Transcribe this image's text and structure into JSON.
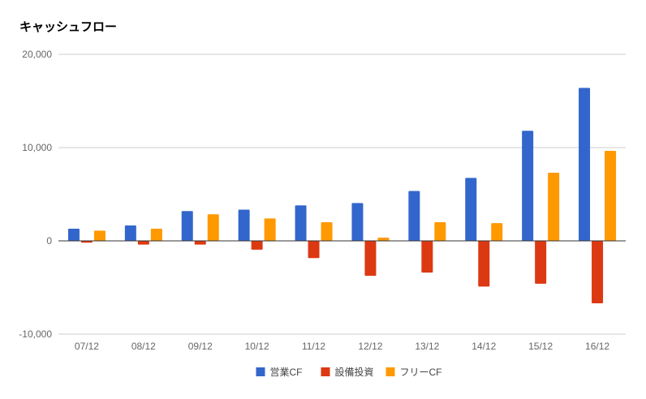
{
  "chart_data": {
    "type": "bar",
    "title": "キャッシュフロー",
    "categories": [
      "07/12",
      "08/12",
      "09/12",
      "10/12",
      "11/12",
      "12/12",
      "13/12",
      "14/12",
      "15/12",
      "16/12"
    ],
    "series": [
      {
        "name": "営業CF",
        "color": "#3366cc",
        "values": [
          1300,
          1650,
          3200,
          3350,
          3800,
          4050,
          5350,
          6750,
          11800,
          16400
        ]
      },
      {
        "name": "設備投資",
        "color": "#dc3912",
        "values": [
          -200,
          -400,
          -400,
          -950,
          -1850,
          -3750,
          -3400,
          -4900,
          -4600,
          -6700
        ]
      },
      {
        "name": "フリーCF",
        "color": "#ff9900",
        "values": [
          1100,
          1300,
          2850,
          2400,
          2000,
          350,
          2000,
          1900,
          7300,
          9650
        ]
      }
    ],
    "ylim": [
      -10000,
      20000
    ],
    "yticks": [
      -10000,
      0,
      10000,
      20000
    ],
    "ytick_labels": [
      "-10,000",
      "0",
      "10,000",
      "20,000"
    ],
    "grid": true,
    "legend_position": "bottom"
  }
}
